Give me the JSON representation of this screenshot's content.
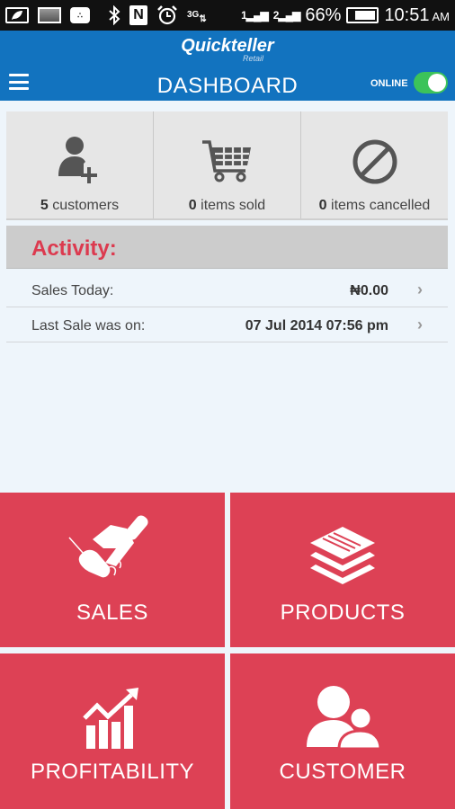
{
  "status_bar": {
    "battery_percent": "66%",
    "time": "10:51",
    "ampm": "AM",
    "network": "3G",
    "sim1": "1",
    "sim2": "2",
    "icons": [
      "leaf-battery-saver-icon",
      "image-icon",
      "bbm-chat-icon",
      "bluetooth-icon",
      "nfc-icon",
      "alarm-icon",
      "3g-data-icon",
      "signal-sim1-icon",
      "signal-sim2-icon",
      "battery-icon"
    ]
  },
  "header": {
    "logo": "Quickteller",
    "logo_sub": "Retail",
    "title": "DASHBOARD",
    "online_label": "ONLINE",
    "online": true,
    "accent": "#1273bf",
    "toggle_color": "#3cc35a"
  },
  "stats": [
    {
      "count": "5",
      "label": "customers",
      "icon": "add-user-icon"
    },
    {
      "count": "0",
      "label": "items sold",
      "icon": "shopping-cart-icon"
    },
    {
      "count": "0",
      "label": "items cancelled",
      "icon": "cancel-icon"
    }
  ],
  "activity": {
    "title": "Activity:",
    "rows": [
      {
        "label": "Sales Today:",
        "value": "₦0.00"
      },
      {
        "label": "Last Sale was on:",
        "value": "07 Jul 2014 07:56 pm"
      }
    ],
    "chevron": "›"
  },
  "tiles": [
    {
      "label": "SALES",
      "icon": "handshake-icon"
    },
    {
      "label": "PRODUCTS",
      "icon": "layers-icon"
    },
    {
      "label": "PROFITABILITY",
      "icon": "growth-chart-icon"
    },
    {
      "label": "CUSTOMER",
      "icon": "users-icon"
    }
  ],
  "colors": {
    "tile": "#dd4155",
    "activity_title": "#dc3a4f"
  }
}
